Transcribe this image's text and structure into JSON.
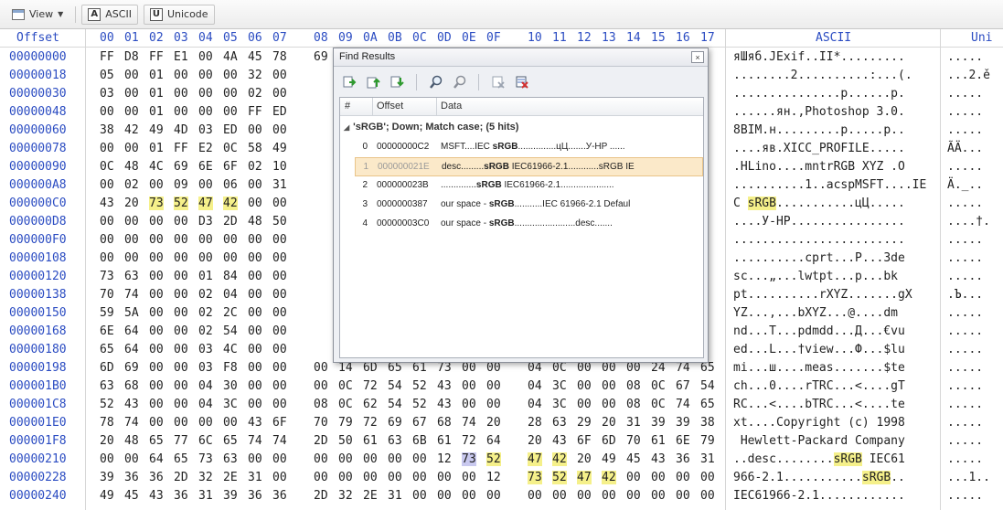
{
  "toolbar": {
    "view_label": "View",
    "ascii_label": "ASCII",
    "unicode_label": "Unicode",
    "ascii_letter": "A",
    "unicode_letter": "U"
  },
  "hex": {
    "offset_header": "Offset",
    "columns": [
      "00",
      "01",
      "02",
      "03",
      "04",
      "05",
      "06",
      "07",
      "08",
      "09",
      "0A",
      "0B",
      "0C",
      "0D",
      "0E",
      "0F",
      "10",
      "11",
      "12",
      "13",
      "14",
      "15",
      "16",
      "17"
    ],
    "ascii_header": "ASCII",
    "unicode_header": "Uni",
    "rows": [
      {
        "offset": "00000000",
        "bytes": [
          "FF",
          "D8",
          "FF",
          "E1",
          "00",
          "4A",
          "45",
          "78",
          "69",
          "",
          "",
          "",
          "",
          "",
          "",
          "",
          "",
          "",
          "",
          "",
          "",
          "",
          "",
          ""
        ],
        "ascii": "яШяб.JExif..II*.........",
        "unicode": "....."
      },
      {
        "offset": "00000018",
        "bytes": [
          "05",
          "00",
          "01",
          "00",
          "00",
          "00",
          "32",
          "00",
          "",
          "",
          "",
          "",
          "",
          "",
          "",
          "",
          "",
          "",
          "",
          "",
          "",
          "",
          "",
          ""
        ],
        "ascii": "........2..........:...(.",
        "unicode": "...2.ě"
      },
      {
        "offset": "00000030",
        "bytes": [
          "03",
          "00",
          "01",
          "00",
          "00",
          "00",
          "02",
          "00",
          "",
          "",
          "",
          "",
          "",
          "",
          "",
          "",
          "",
          "",
          "",
          "",
          "",
          "",
          "",
          ""
        ],
        "ascii": "...............p......p.",
        "unicode": "....."
      },
      {
        "offset": "00000048",
        "bytes": [
          "00",
          "00",
          "01",
          "00",
          "00",
          "00",
          "FF",
          "ED",
          "",
          "",
          "",
          "",
          "",
          "",
          "",
          "",
          "",
          "",
          "",
          "",
          "",
          "",
          "",
          ""
        ],
        "ascii": "......ян.,Photoshop 3.0.",
        "unicode": "....."
      },
      {
        "offset": "00000060",
        "bytes": [
          "38",
          "42",
          "49",
          "4D",
          "03",
          "ED",
          "00",
          "00",
          "",
          "",
          "",
          "",
          "",
          "",
          "",
          "",
          "",
          "",
          "",
          "",
          "",
          "",
          "",
          ""
        ],
        "ascii": "8BIM.н.........p.....p..",
        "unicode": "....."
      },
      {
        "offset": "00000078",
        "bytes": [
          "00",
          "00",
          "01",
          "FF",
          "E2",
          "0C",
          "58",
          "49",
          "",
          "",
          "",
          "",
          "",
          "",
          "",
          "",
          "",
          "",
          "",
          "",
          "",
          "",
          "",
          ""
        ],
        "ascii": "....яв.XICC_PROFILE.....",
        "unicode": "ÃÄ..."
      },
      {
        "offset": "00000090",
        "bytes": [
          "0C",
          "48",
          "4C",
          "69",
          "6E",
          "6F",
          "02",
          "10",
          "",
          "",
          "",
          "",
          "",
          "",
          "",
          "",
          "",
          "",
          "",
          "",
          "",
          "",
          "",
          ""
        ],
        "ascii": ".HLino....mntrRGB XYZ .O",
        "unicode": "....."
      },
      {
        "offset": "000000A8",
        "bytes": [
          "00",
          "02",
          "00",
          "09",
          "00",
          "06",
          "00",
          "31",
          "",
          "",
          "",
          "",
          "",
          "",
          "",
          "",
          "",
          "",
          "",
          "",
          "",
          "",
          "",
          ""
        ],
        "ascii": "..........1..acspMSFT....IE",
        "unicode": "Ä._.."
      },
      {
        "offset": "000000C0",
        "bytes": [
          "43",
          "20",
          "73",
          "52",
          "47",
          "42",
          "00",
          "00",
          "",
          "",
          "",
          "",
          "",
          "",
          "",
          "",
          "",
          "",
          "",
          "",
          "",
          "",
          "",
          ""
        ],
        "ascii": "C sRGB...........цЦ.....",
        "unicode": "....."
      },
      {
        "offset": "000000D8",
        "bytes": [
          "00",
          "00",
          "00",
          "00",
          "D3",
          "2D",
          "48",
          "50",
          "",
          "",
          "",
          "",
          "",
          "",
          "",
          "",
          "",
          "",
          "",
          "",
          "",
          "",
          "",
          ""
        ],
        "ascii": "....У-HP................",
        "unicode": "....†."
      },
      {
        "offset": "000000F0",
        "bytes": [
          "00",
          "00",
          "00",
          "00",
          "00",
          "00",
          "00",
          "00",
          "",
          "",
          "",
          "",
          "",
          "",
          "",
          "",
          "",
          "",
          "",
          "",
          "",
          "",
          "",
          ""
        ],
        "ascii": "........................",
        "unicode": "....."
      },
      {
        "offset": "00000108",
        "bytes": [
          "00",
          "00",
          "00",
          "00",
          "00",
          "00",
          "00",
          "00",
          "",
          "",
          "",
          "",
          "",
          "",
          "",
          "",
          "",
          "",
          "",
          "",
          "",
          "",
          "",
          ""
        ],
        "ascii": "..........cprt...P...3de",
        "unicode": "....."
      },
      {
        "offset": "00000120",
        "bytes": [
          "73",
          "63",
          "00",
          "00",
          "01",
          "84",
          "00",
          "00",
          "",
          "",
          "",
          "",
          "",
          "",
          "",
          "",
          "",
          "",
          "",
          "",
          "",
          "",
          "",
          ""
        ],
        "ascii": "sc...„...lwtpt...p...bk",
        "unicode": "....."
      },
      {
        "offset": "00000138",
        "bytes": [
          "70",
          "74",
          "00",
          "00",
          "02",
          "04",
          "00",
          "00",
          "",
          "",
          "",
          "",
          "",
          "",
          "",
          "",
          "",
          "",
          "",
          "",
          "",
          "",
          "",
          ""
        ],
        "ascii": "pt..........rXYZ.......gX",
        "unicode": ".Ъ..."
      },
      {
        "offset": "00000150",
        "bytes": [
          "59",
          "5A",
          "00",
          "00",
          "02",
          "2C",
          "00",
          "00",
          "",
          "",
          "",
          "",
          "",
          "",
          "",
          "",
          "",
          "",
          "",
          "",
          "",
          "",
          "",
          ""
        ],
        "ascii": "YZ...,...bXYZ...@....dm",
        "unicode": "....."
      },
      {
        "offset": "00000168",
        "bytes": [
          "6E",
          "64",
          "00",
          "00",
          "02",
          "54",
          "00",
          "00",
          "",
          "",
          "",
          "",
          "",
          "",
          "",
          "",
          "",
          "",
          "",
          "",
          "",
          "",
          "",
          ""
        ],
        "ascii": "nd...T...pdmdd...Д...€vu",
        "unicode": "....."
      },
      {
        "offset": "00000180",
        "bytes": [
          "65",
          "64",
          "00",
          "00",
          "03",
          "4C",
          "00",
          "00",
          "",
          "",
          "",
          "",
          "",
          "",
          "",
          "",
          "",
          "",
          "",
          "",
          "",
          "",
          "",
          ""
        ],
        "ascii": "ed...L...†view...Ф...$lu",
        "unicode": "....."
      },
      {
        "offset": "00000198",
        "bytes": [
          "6D",
          "69",
          "00",
          "00",
          "03",
          "F8",
          "00",
          "00",
          "00",
          "14",
          "6D",
          "65",
          "61",
          "73",
          "00",
          "00",
          "04",
          "0C",
          "00",
          "00",
          "00",
          "24",
          "74",
          "65"
        ],
        "ascii": "mi...ш....meas.......$te",
        "unicode": "....."
      },
      {
        "offset": "000001B0",
        "bytes": [
          "63",
          "68",
          "00",
          "00",
          "04",
          "30",
          "00",
          "00",
          "00",
          "0C",
          "72",
          "54",
          "52",
          "43",
          "00",
          "00",
          "04",
          "3C",
          "00",
          "00",
          "08",
          "0C",
          "67",
          "54"
        ],
        "ascii": "ch...0....rTRC...<....gT",
        "unicode": "....."
      },
      {
        "offset": "000001C8",
        "bytes": [
          "52",
          "43",
          "00",
          "00",
          "04",
          "3C",
          "00",
          "00",
          "08",
          "0C",
          "62",
          "54",
          "52",
          "43",
          "00",
          "00",
          "04",
          "3C",
          "00",
          "00",
          "08",
          "0C",
          "74",
          "65"
        ],
        "ascii": "RC...<....bTRC...<....te",
        "unicode": "....."
      },
      {
        "offset": "000001E0",
        "bytes": [
          "78",
          "74",
          "00",
          "00",
          "00",
          "00",
          "43",
          "6F",
          "70",
          "79",
          "72",
          "69",
          "67",
          "68",
          "74",
          "20",
          "28",
          "63",
          "29",
          "20",
          "31",
          "39",
          "39",
          "38"
        ],
        "ascii": "xt....Copyright (c) 1998",
        "unicode": "....."
      },
      {
        "offset": "000001F8",
        "bytes": [
          "20",
          "48",
          "65",
          "77",
          "6C",
          "65",
          "74",
          "74",
          "2D",
          "50",
          "61",
          "63",
          "6B",
          "61",
          "72",
          "64",
          "20",
          "43",
          "6F",
          "6D",
          "70",
          "61",
          "6E",
          "79"
        ],
        "ascii": " Hewlett-Packard Company",
        "unicode": "....."
      },
      {
        "offset": "00000210",
        "bytes": [
          "00",
          "00",
          "64",
          "65",
          "73",
          "63",
          "00",
          "00",
          "00",
          "00",
          "00",
          "00",
          "00",
          "12",
          "73",
          "52",
          "47",
          "42",
          "20",
          "49",
          "45",
          "43",
          "36",
          "31"
        ],
        "ascii": "..desc........sRGB IEC61",
        "unicode": "....."
      },
      {
        "offset": "00000228",
        "bytes": [
          "39",
          "36",
          "36",
          "2D",
          "32",
          "2E",
          "31",
          "00",
          "00",
          "00",
          "00",
          "00",
          "00",
          "00",
          "00",
          "12",
          "73",
          "52",
          "47",
          "42",
          "00",
          "00",
          "00",
          "00"
        ],
        "ascii": "966-2.1...........sRGB..",
        "unicode": "...1.."
      },
      {
        "offset": "00000240",
        "bytes": [
          "49",
          "45",
          "43",
          "36",
          "31",
          "39",
          "36",
          "36",
          "2D",
          "32",
          "2E",
          "31",
          "00",
          "00",
          "00",
          "00",
          "00",
          "00",
          "00",
          "00",
          "00",
          "00",
          "00",
          "00"
        ],
        "ascii": "IEC61966-2.1............",
        "unicode": "....."
      }
    ]
  },
  "find": {
    "title": "Find Results",
    "close_glyph": "×",
    "col_num": "#",
    "col_offset": "Offset",
    "col_data": "Data",
    "group_label": "'sRGB'; Down; Match case; (5 hits)",
    "group_toggle": "◢",
    "results": [
      {
        "num": "0",
        "offset": "00000000C2",
        "pre": "MSFT....IEC ",
        "match": "sRGB",
        "post": "...............цЦ.......У-HP ......"
      },
      {
        "num": "1",
        "offset": "000000021E",
        "pre": "desc.........",
        "match": "sRGB",
        "post": " IEC61966-2.1............sRGB IE"
      },
      {
        "num": "2",
        "offset": "000000023B",
        "pre": "..............",
        "match": "sRGB",
        "post": " IEC61966-2.1....................."
      },
      {
        "num": "3",
        "offset": "0000000387",
        "pre": "our space - ",
        "match": "sRGB",
        "post": "...........IEC 61966-2.1 Defaul"
      },
      {
        "num": "4",
        "offset": "00000003C0",
        "pre": "our space - ",
        "match": "sRGB",
        "post": "........................desc......."
      }
    ],
    "selected_index": 1
  }
}
